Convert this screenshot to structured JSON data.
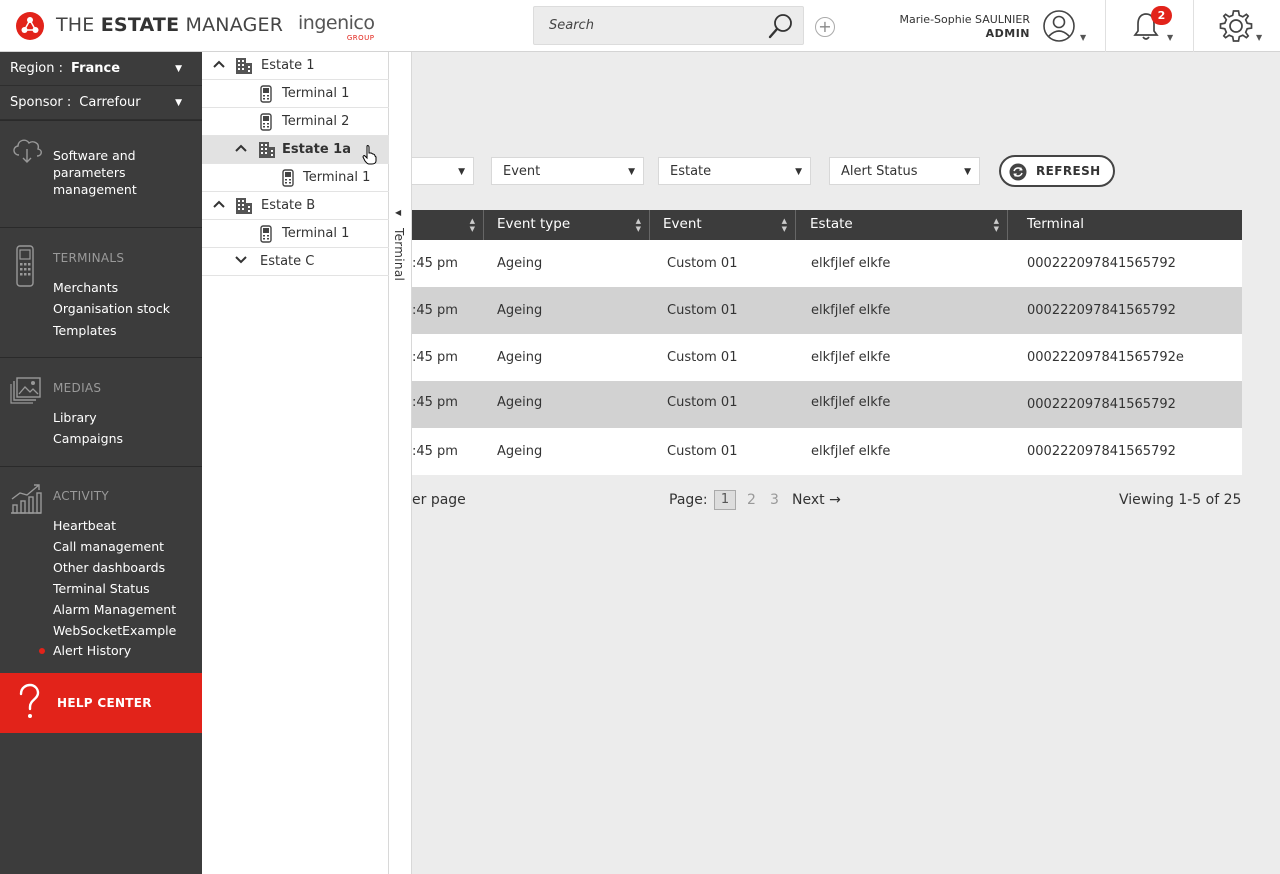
{
  "header": {
    "brand_light": "THE ",
    "brand_bold": "ESTATE",
    "brand_rest": " MANAGER",
    "partner_name": "ingenico",
    "partner_group": "GROUP",
    "search_placeholder": "Search",
    "user_name": "Marie-Sophie SAULNIER",
    "user_role": "ADMIN",
    "notification_count": "2",
    "accent_color": "#e2231a"
  },
  "sidebar": {
    "region_label": "Region :",
    "region_value": "France",
    "sponsor_label": "Sponsor :",
    "sponsor_value": "Carrefour",
    "software": [
      "Software and",
      "parameters",
      "management"
    ],
    "terminals_title": "TERMINALS",
    "terminals_items": [
      "Merchants",
      "Organisation stock",
      "Templates"
    ],
    "medias_title": "MEDIAS",
    "medias_items": [
      "Library",
      "Campaigns"
    ],
    "activity_title": "ACTIVITY",
    "activity_items": [
      "Heartbeat",
      "Call management",
      "Other dashboards",
      "Terminal Status",
      "Alarm Management",
      "WebSocketExample",
      "Alert History"
    ],
    "help_label": "HELP CENTER"
  },
  "tree": {
    "nodes": [
      {
        "label": "Estate 1"
      },
      {
        "label": "Terminal 1"
      },
      {
        "label": "Terminal 2"
      },
      {
        "label": "Estate 1a"
      },
      {
        "label": "Terminal 1"
      },
      {
        "label": "Estate B"
      },
      {
        "label": "Terminal 1"
      },
      {
        "label": "Estate C"
      }
    ],
    "tab_label": "Terminal"
  },
  "filters": {
    "event": "Event",
    "estate": "Estate",
    "alert_status": "Alert Status",
    "refresh": "REFRESH"
  },
  "table": {
    "headers": [
      "Event type",
      "Event",
      "Estate",
      "Terminal"
    ],
    "rows": [
      {
        "time": ":45 pm",
        "event_type": "Ageing",
        "event": "Custom 01",
        "estate": "elkfjlef elkfe",
        "terminal": "000222097841565792"
      },
      {
        "time": ":45 pm",
        "event_type": "Ageing",
        "event": "Custom 01",
        "estate": "elkfjlef elkfe",
        "terminal": "000222097841565792"
      },
      {
        "time": ":45 pm",
        "event_type": "Ageing",
        "event": "Custom 01",
        "estate": "elkfjlef elkfe",
        "terminal": "000222097841565792e"
      },
      {
        "time": ":45 pm",
        "event_type": "Ageing",
        "event": "Custom 01",
        "estate": "elkfjlef elkfe",
        "terminal": "000222097841565792"
      },
      {
        "time": ":45 pm",
        "event_type": "Ageing",
        "event": "Custom 01",
        "estate": "elkfjlef elkfe",
        "terminal": "000222097841565792"
      }
    ]
  },
  "pagination": {
    "per_page_fragment": "er page",
    "page_label": "Page:",
    "current": "1",
    "page2": "2",
    "page3": "3",
    "next": "Next →",
    "viewing": "Viewing 1-5 of 25"
  }
}
